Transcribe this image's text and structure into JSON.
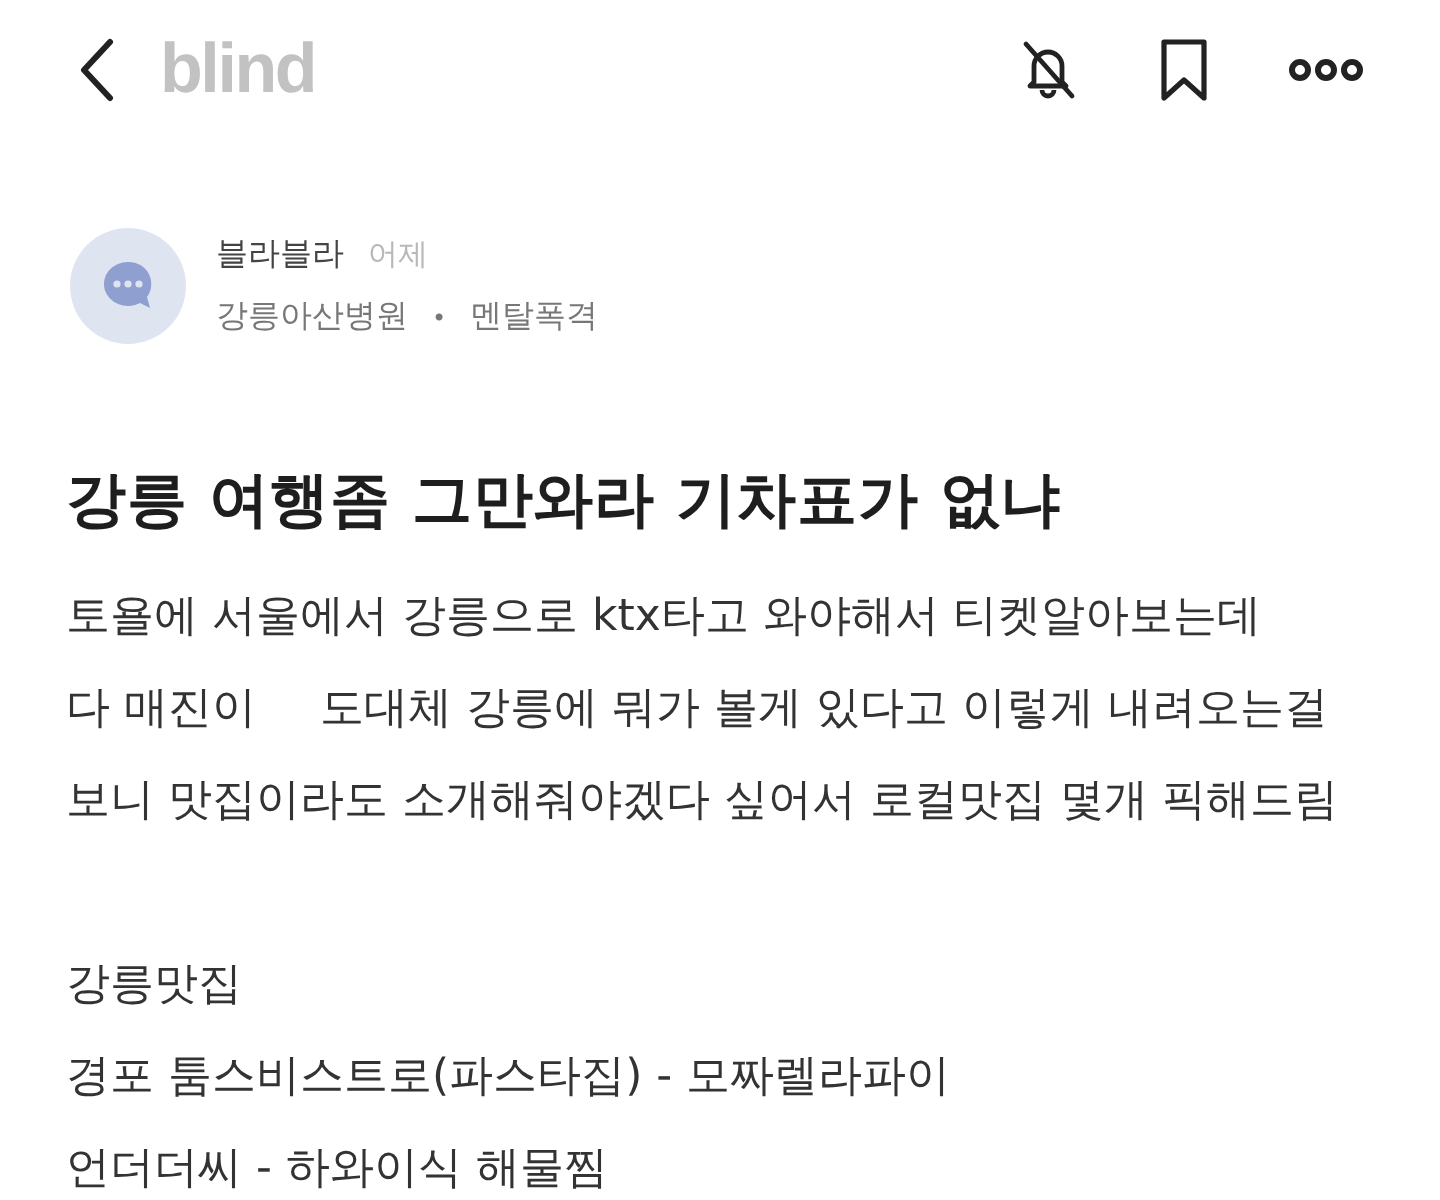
{
  "header": {
    "logo": "blind",
    "notifications_muted": true
  },
  "author": {
    "name": "블라블라",
    "time": "어제",
    "company": "강릉아산병원",
    "separator": "•",
    "topic": "멘탈폭격"
  },
  "post": {
    "title": "강릉 여행좀 그만와라 기차표가 없냐",
    "body_lines": [
      {
        "parts": [
          "토욜에 서울에서 강릉으로 ktx타고 와야해서 티켓알아보는데"
        ]
      },
      {
        "parts": [
          "다 매진이",
          "도대체 강릉에 뭐가 볼게 있다고 이렇게 내려오는걸"
        ]
      },
      {
        "parts": [
          "보니 맛집이라도 소개해줘야겠다 싶어서 로컬맛집 몇개 픽해드림"
        ]
      }
    ],
    "list_lines": [
      "강릉맛집",
      "경포 툼스비스트로(파스타집) - 모짜렐라파이",
      "언더더씨 - 하와이식 해물찜"
    ]
  }
}
